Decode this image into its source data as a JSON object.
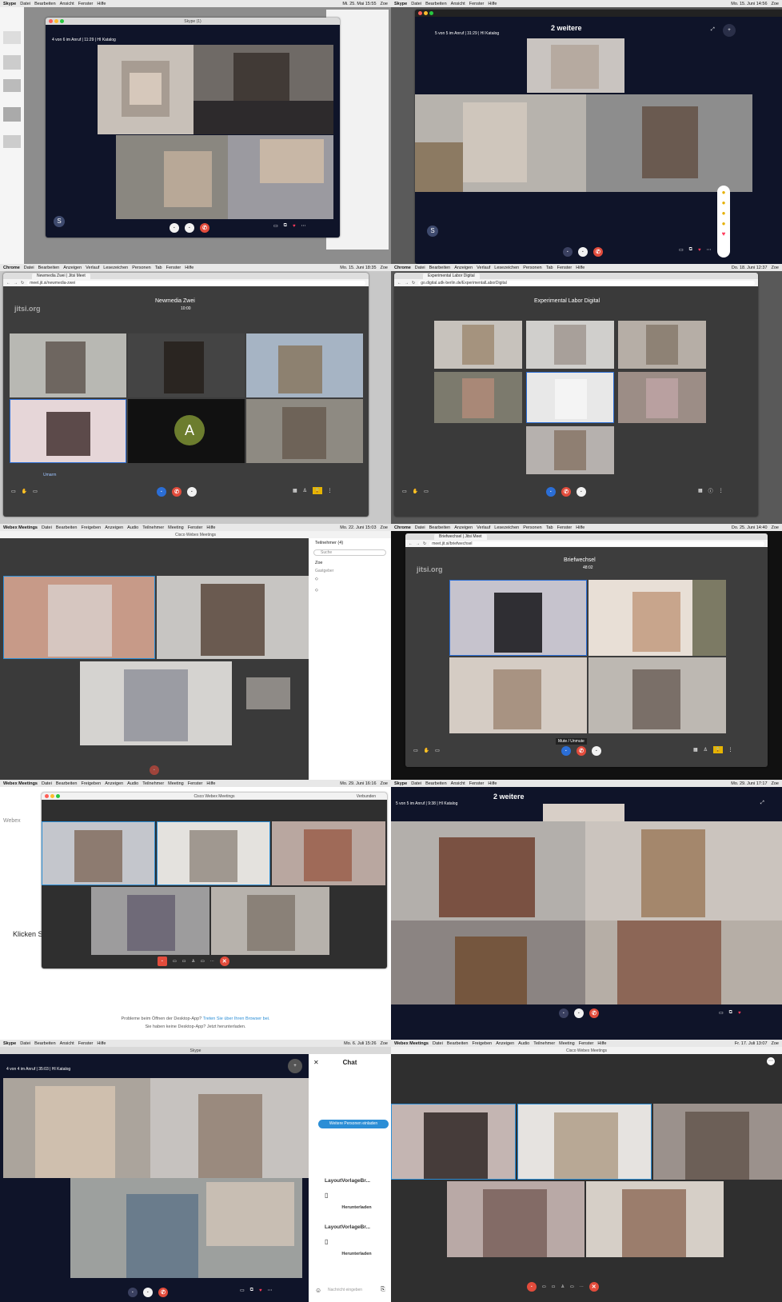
{
  "panels": [
    {
      "menubar": {
        "app": "Skype",
        "items": [
          "Datei",
          "Bearbeiten",
          "Ansicht",
          "Fenster",
          "Hilfe"
        ],
        "clock": "Mi. 25. Mai 15:55",
        "user": "Zoe"
      },
      "window_title": "Skype (1)",
      "call_info": "4 von 6 im Anruf | 11:29 | HI Katalog"
    },
    {
      "menubar": {
        "app": "Skype",
        "items": [
          "Datei",
          "Bearbeiten",
          "Ansicht",
          "Fenster",
          "Hilfe"
        ],
        "clock": "Mo. 15. Juni 14:56",
        "user": "Zoe"
      },
      "call_info": "5 von 5 im Anruf | 31:29 | HI Katalog",
      "overflow_label": "2 weitere"
    },
    {
      "menubar": {
        "app": "Chrome",
        "items": [
          "Datei",
          "Bearbeiten",
          "Anzeigen",
          "Verlauf",
          "Lesezeichen",
          "Personen",
          "Tab",
          "Fenster",
          "Hilfe"
        ],
        "clock": "Mo. 15. Juni 18:35",
        "user": "Zoe"
      },
      "tab": "Newmedia Zwei | Jitsi Meet",
      "url": "meet.jit.si/newmedia-zwei",
      "logo": "jitsi.org",
      "room": "Newmedia Zwei",
      "timer": "10:00",
      "avatar_letter": "A",
      "tooltip": "Umarm"
    },
    {
      "menubar": {
        "app": "Chrome",
        "items": [
          "Datei",
          "Bearbeiten",
          "Anzeigen",
          "Verlauf",
          "Lesezeichen",
          "Personen",
          "Tab",
          "Fenster",
          "Hilfe"
        ],
        "clock": "Do. 18. Juni 12:37",
        "user": "Zoe"
      },
      "tab": "Experimental Labor Digital",
      "url": "go.digital.udk-berlin.de/ExperimentalLaborDigital",
      "room": "Experimental Labor Digital"
    },
    {
      "menubar": {
        "app": "Webex Meetings",
        "items": [
          "Datei",
          "Bearbeiten",
          "Freigeben",
          "Anzeigen",
          "Audio",
          "Teilnehmer",
          "Meeting",
          "Fenster",
          "Hilfe"
        ],
        "clock": "Mo. 22. Juni 15:03",
        "user": "Zoe"
      },
      "window_title": "Cisco Webex Meetings",
      "participants_title": "Teilnehmer (4)",
      "search_placeholder": "Suche",
      "participants": [
        "Zoe",
        "Gastgeber",
        "",
        ""
      ]
    },
    {
      "menubar": {
        "app": "Chrome",
        "items": [
          "Datei",
          "Bearbeiten",
          "Anzeigen",
          "Verlauf",
          "Lesezeichen",
          "Personen",
          "Tab",
          "Fenster",
          "Hilfe"
        ],
        "clock": "Do. 25. Juni 14:40",
        "user": "Zoe"
      },
      "tab": "Briefwechsel | Jitsi Meet",
      "url": "meet.jit.si/briefwechsel",
      "logo": "jitsi.org",
      "room": "Briefwechsel",
      "timer": "48:02",
      "mute_tooltip": "Mute / Unmute"
    },
    {
      "menubar": {
        "app": "Webex Meetings",
        "items": [
          "Datei",
          "Bearbeiten",
          "Freigeben",
          "Anzeigen",
          "Audio",
          "Teilnehmer",
          "Meeting",
          "Fenster",
          "Hilfe"
        ],
        "clock": "Mo. 29. Juni 16:16",
        "user": "Zoe"
      },
      "window_title": "Cisco Webex Meetings",
      "status": "Verbunden",
      "side_label": "Webex",
      "click_text": "Klicken S",
      "problem_text": "Probleme beim Öffnen der Desktop-App?",
      "problem_link": "Treten Sie über Ihren Browser bei.",
      "no_app_text": "Sie haben keine Desktop-App? Jetzt herunterladen."
    },
    {
      "menubar": {
        "app": "Skype",
        "items": [
          "Datei",
          "Bearbeiten",
          "Ansicht",
          "Fenster",
          "Hilfe"
        ],
        "clock": "Mo. 29. Juni 17:17",
        "user": "Zoe"
      },
      "call_info": "5 von 5 im Anruf | 9:38 | HI Katalog",
      "overflow_label": "2 weitere"
    },
    {
      "menubar": {
        "app": "Skype",
        "items": [
          "Datei",
          "Bearbeiten",
          "Ansicht",
          "Fenster",
          "Hilfe"
        ],
        "clock": "Mo. 6. Juli 15:26",
        "user": "Zoe"
      },
      "window_title": "Skype",
      "call_info": "4 von 4 im Anruf | 35:03 | HI Katalog",
      "chat_title": "Chat",
      "invite_button": "Weitere Personen einladen",
      "file1_name": "LayoutVorlageBr...",
      "file2_name": "LayoutVorlageBr...",
      "download": "Herunterladen",
      "input_placeholder": "Nachricht eingeben"
    },
    {
      "menubar": {
        "app": "Webex Meetings",
        "items": [
          "Datei",
          "Bearbeiten",
          "Freigeben",
          "Anzeigen",
          "Audio",
          "Teilnehmer",
          "Meeting",
          "Fenster",
          "Hilfe"
        ],
        "clock": "Fr. 17. Juli 13:07",
        "user": "Zoe"
      },
      "window_title": "Cisco Webex Meetings"
    }
  ],
  "colors": {
    "hangup": "#e24c3c",
    "jitsi_bg": "#3d3d3d",
    "skype_bg": "#0f1429",
    "webex_bg": "#2f2f2f",
    "accent": "#2b8ed6"
  }
}
